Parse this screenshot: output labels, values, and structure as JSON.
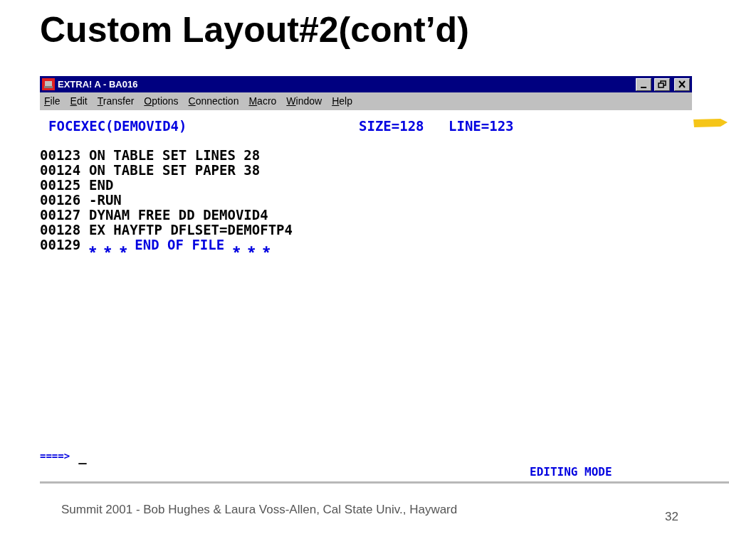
{
  "slide": {
    "title": "Custom Layout#2(cont’d)",
    "footer": "Summit 2001 - Bob Hughes & Laura Voss-Allen, Cal State Univ., Hayward",
    "page_number": "32"
  },
  "window": {
    "title": "EXTRA! A - BA016"
  },
  "menu": [
    "File",
    "Edit",
    "Transfer",
    "Options",
    "Connection",
    "Macro",
    "Window",
    "Help"
  ],
  "header": {
    "name": "FOCEXEC(DEMOVID4)",
    "size": "SIZE=128",
    "line": "LINE=123"
  },
  "lines": [
    {
      "number": "00123",
      "text": "ON TABLE SET LINES 28",
      "kind": "code"
    },
    {
      "number": "00124",
      "text": "ON TABLE SET PAPER 38",
      "kind": "code"
    },
    {
      "number": "00125",
      "text": "END",
      "kind": "code"
    },
    {
      "number": "00126",
      "text": "-RUN",
      "kind": "code"
    },
    {
      "number": "00127",
      "text": "DYNAM FREE DD DEMOVID4",
      "kind": "code"
    },
    {
      "number": "00128",
      "text": "EX HAYFTP DFLSET=DEMOFTP4",
      "kind": "code"
    },
    {
      "number": "00129",
      "text": "⁎ ⁎ ⁎ END OF FILE ⁎ ⁎ ⁎",
      "kind": "marker"
    }
  ],
  "command": {
    "prompt": "====>",
    "value": "_"
  },
  "status": "EDITING MODE"
}
